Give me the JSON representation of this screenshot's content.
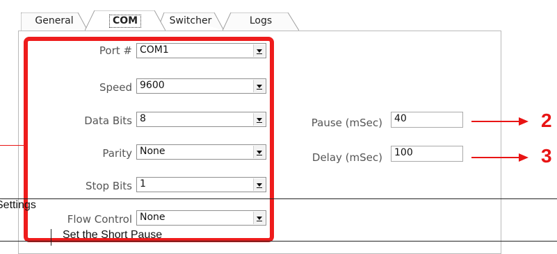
{
  "tabs": [
    {
      "label": "General"
    },
    {
      "label": "COM"
    },
    {
      "label": "Switcher"
    },
    {
      "label": "Logs"
    }
  ],
  "com": {
    "port_label": "Port #",
    "port_value": "COM1",
    "speed_label": "Speed",
    "speed_value": "9600",
    "databits_label": "Data Bits",
    "databits_value": "8",
    "parity_label": "Parity",
    "parity_value": "None",
    "stopbits_label": "Stop Bits",
    "stopbits_value": "1",
    "flow_label": "Flow Control",
    "flow_value": "None",
    "pause_label": "Pause (mSec)",
    "pause_value": "40",
    "delay_label": "Delay (mSec)",
    "delay_value": "100"
  },
  "callouts": {
    "two": "2",
    "three": "3",
    "accent": "#ee1c1c"
  },
  "annotation_table": {
    "settings_text": "Settings",
    "short_pause_text": "Set the Short Pause"
  }
}
